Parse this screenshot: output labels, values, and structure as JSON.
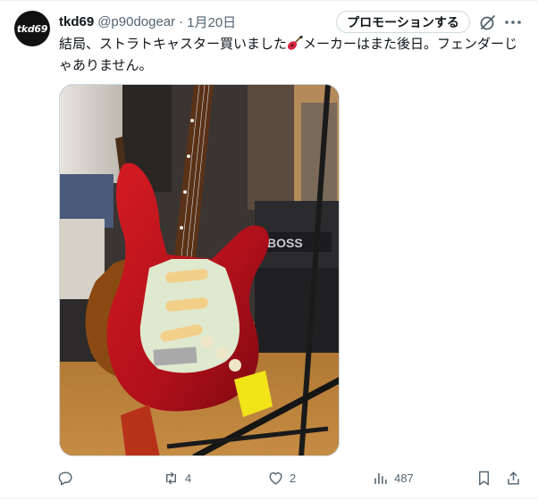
{
  "author": {
    "avatar_text": "tkd69",
    "display_name": "tkd69",
    "handle": "@p90dogear",
    "separator": "·",
    "date": "1月20日"
  },
  "header_actions": {
    "promote_label": "プロモーションする"
  },
  "tweet": {
    "text_part1": "結局、ストラトキャスター買いました",
    "text_part2": "メーカーはまた後日。フェンダーじゃありません。"
  },
  "media": {
    "amp_brand_text": "BOSS"
  },
  "actions": {
    "replies": "",
    "reposts": "4",
    "likes": "2",
    "views": "487"
  },
  "colors": {
    "text_primary": "#0f1419",
    "text_secondary": "#536471",
    "border": "#cfd9de",
    "guitar_body": "#b4141c",
    "pickguard": "#dfe9cf"
  }
}
